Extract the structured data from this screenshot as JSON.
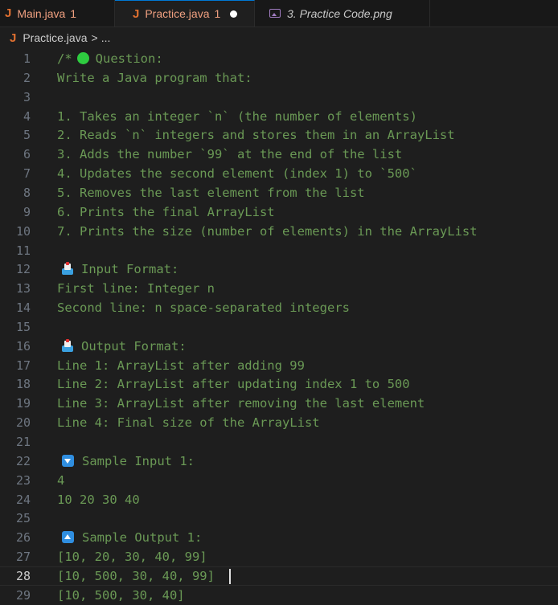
{
  "tabs": [
    {
      "label": "Main.java",
      "badge": "1"
    },
    {
      "label": "Practice.java",
      "badge": "1"
    },
    {
      "label": "3. Practice Code.png"
    }
  ],
  "breadcrumb": {
    "file": "Practice.java",
    "more": "..."
  },
  "editor": {
    "current_line": 28,
    "lines": [
      {
        "n": "1",
        "text": "Question:",
        "prefix": "/*"
      },
      {
        "n": "2",
        "text": "Write a Java program that:"
      },
      {
        "n": "3",
        "text": ""
      },
      {
        "n": "4",
        "text": "1. Takes an integer `n` (the number of elements)"
      },
      {
        "n": "5",
        "text": "2. Reads `n` integers and stores them in an ArrayList"
      },
      {
        "n": "6",
        "text": "3. Adds the number `99` at the end of the list"
      },
      {
        "n": "7",
        "text": "4. Updates the second element (index 1) to `500`"
      },
      {
        "n": "8",
        "text": "5. Removes the last element from the list"
      },
      {
        "n": "9",
        "text": "6. Prints the final ArrayList"
      },
      {
        "n": "10",
        "text": "7. Prints the size (number of elements) in the ArrayList"
      },
      {
        "n": "11",
        "text": ""
      },
      {
        "n": "12",
        "text": "Input Format:"
      },
      {
        "n": "13",
        "text": "First line: Integer n"
      },
      {
        "n": "14",
        "text": "Second line: n space-separated integers"
      },
      {
        "n": "15",
        "text": ""
      },
      {
        "n": "16",
        "text": "Output Format:"
      },
      {
        "n": "17",
        "text": "Line 1: ArrayList after adding 99"
      },
      {
        "n": "18",
        "text": "Line 2: ArrayList after updating index 1 to 500"
      },
      {
        "n": "19",
        "text": "Line 3: ArrayList after removing the last element"
      },
      {
        "n": "20",
        "text": "Line 4: Final size of the ArrayList"
      },
      {
        "n": "21",
        "text": ""
      },
      {
        "n": "22",
        "text": "Sample Input 1:"
      },
      {
        "n": "23",
        "text": "4"
      },
      {
        "n": "24",
        "text": "10 20 30 40"
      },
      {
        "n": "25",
        "text": ""
      },
      {
        "n": "26",
        "text": "Sample Output 1:"
      },
      {
        "n": "27",
        "text": "[10, 20, 30, 40, 99]"
      },
      {
        "n": "28",
        "text": "[10, 500, 30, 40, 99]"
      },
      {
        "n": "29",
        "text": "[10, 500, 30, 40]"
      }
    ]
  },
  "icons": {
    "line1": "green-circle-icon",
    "line12": "inbox-tray-icon",
    "line16": "inbox-tray-icon",
    "line22": "down-button-icon",
    "line26": "up-button-icon"
  },
  "colors": {
    "comment": "#6a9955",
    "java": "#e07030",
    "active_tab_border": "#0078d4"
  }
}
